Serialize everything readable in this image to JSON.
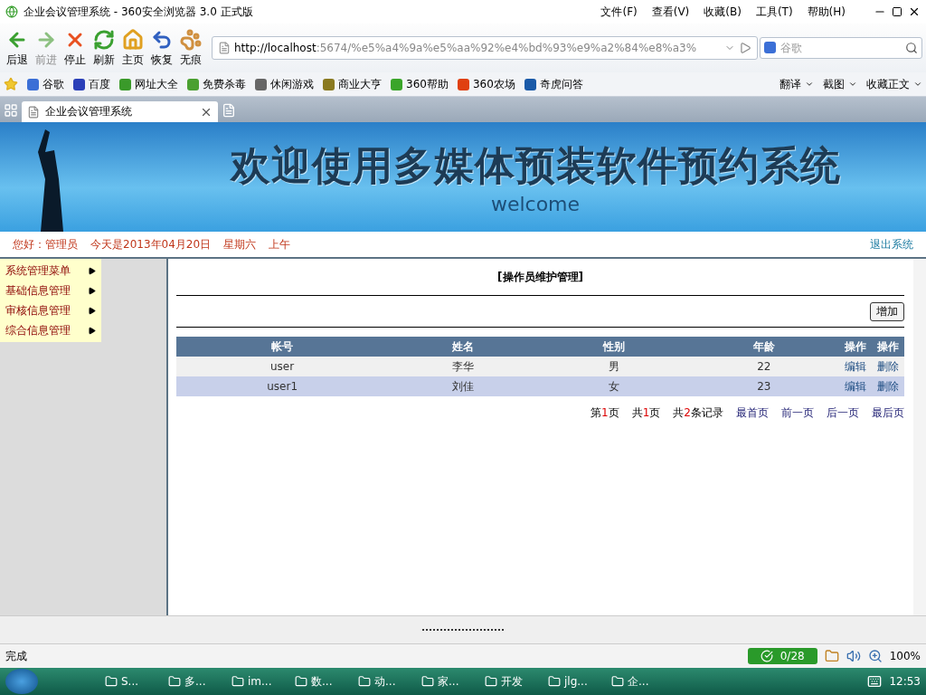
{
  "window": {
    "title": "企业会议管理系统 - 360安全浏览器 3.0 正式版"
  },
  "menu": [
    "文件(F)",
    "查看(V)",
    "收藏(B)",
    "工具(T)",
    "帮助(H)"
  ],
  "nav_buttons": [
    {
      "kind": "back",
      "label": "后退",
      "disabled": false
    },
    {
      "kind": "forward",
      "label": "前进",
      "disabled": true
    },
    {
      "kind": "stop",
      "label": "停止",
      "disabled": false
    },
    {
      "kind": "refresh",
      "label": "刷新",
      "disabled": false
    },
    {
      "kind": "home",
      "label": "主页",
      "disabled": false
    },
    {
      "kind": "undo",
      "label": "恢复",
      "disabled": false
    },
    {
      "kind": "private",
      "label": "无痕",
      "disabled": false
    }
  ],
  "address": {
    "host": "http://localhost",
    "path": ":5674/%e5%a4%9a%e5%aa%92%e4%bd%93%e9%a2%84%e8%a3%"
  },
  "search": {
    "placeholder": "谷歌"
  },
  "favorites": [
    {
      "label": "谷歌",
      "color": "#3b6fd6"
    },
    {
      "label": "百度",
      "color": "#2a3fb8"
    },
    {
      "label": "网址大全",
      "color": "#3a9a2a"
    },
    {
      "label": "免费杀毒",
      "color": "#4aa030"
    },
    {
      "label": "休闲游戏",
      "color": "#666666"
    },
    {
      "label": "商业大亨",
      "color": "#8a7a20"
    },
    {
      "label": "360帮助",
      "color": "#3aa52a"
    },
    {
      "label": "360农场",
      "color": "#e04010"
    },
    {
      "label": "奇虎问答",
      "color": "#1a5aa8"
    }
  ],
  "favorites_right": [
    "翻译",
    "截图",
    "收藏正文"
  ],
  "tabs": [
    {
      "label": "企业会议管理系统",
      "selected": true
    }
  ],
  "banner": {
    "title": "欢迎使用多媒体预装软件预约系统",
    "subtitle": "welcome"
  },
  "info_bar": {
    "greeting": "您好：管理员",
    "date": "今天是2013年04月20日",
    "weekday": "星期六",
    "period": "上午",
    "logout": "退出系统"
  },
  "sidebar": {
    "items": [
      "系统管理菜单",
      "基础信息管理",
      "审核信息管理",
      "综合信息管理"
    ]
  },
  "content": {
    "heading": "[操作员维护管理]",
    "add_button": "增加",
    "table": {
      "columns": [
        "帐号",
        "姓名",
        "性别",
        "年龄",
        "操作",
        "操作"
      ],
      "rows": [
        {
          "cells": [
            "user",
            "李华",
            "男",
            "22"
          ],
          "actions": [
            "编辑",
            "删除"
          ],
          "selected": false
        },
        {
          "cells": [
            "user1",
            "刘佳",
            "女",
            "23"
          ],
          "actions": [
            "编辑",
            "删除"
          ],
          "selected": true
        }
      ]
    },
    "pagination": {
      "page_prefix": "第",
      "page": "1",
      "page_suffix": "页",
      "total_prefix": "共",
      "total_pages": "1",
      "total_suffix": "页",
      "records_prefix": "共",
      "records": "2",
      "records_suffix": "条记录",
      "links": [
        "最首页",
        "前一页",
        "后一页",
        "最后页"
      ]
    }
  },
  "status_bar": {
    "status": "完成",
    "counter": "0/28",
    "zoom": "100%"
  },
  "taskbar": {
    "items": [
      "S...",
      "多...",
      "im...",
      "数...",
      "动...",
      "家...",
      "开发",
      "jlg...",
      "企..."
    ],
    "clock": "12:53"
  }
}
